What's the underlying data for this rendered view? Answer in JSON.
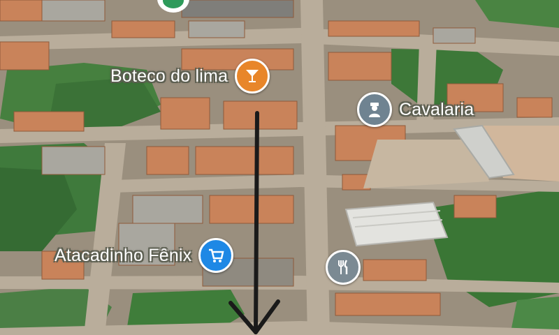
{
  "map": {
    "colors": {
      "vegetation": "#3f7a3c",
      "road": "#b7ac9c",
      "roof_orange": "#c9835a",
      "roof_grey": "#a9a79f",
      "arrow": "#1a1a1a",
      "label_text": "#ffffff"
    },
    "places": [
      {
        "name": "Boteco do lima",
        "icon": "cocktail-glass-icon",
        "pin_color": "#e8862a"
      },
      {
        "name": "Cavalaria",
        "icon": "police-officer-icon",
        "pin_color": "#6f8391"
      },
      {
        "name": "Atacadinho Fênix",
        "icon": "shopping-cart-icon",
        "pin_color": "#1e88e5"
      },
      {
        "name": "",
        "icon": "fork-knife-icon",
        "pin_color": "#7b8a93"
      }
    ],
    "annotation": {
      "type": "arrow",
      "direction": "down",
      "color": "#1a1a1a"
    }
  }
}
